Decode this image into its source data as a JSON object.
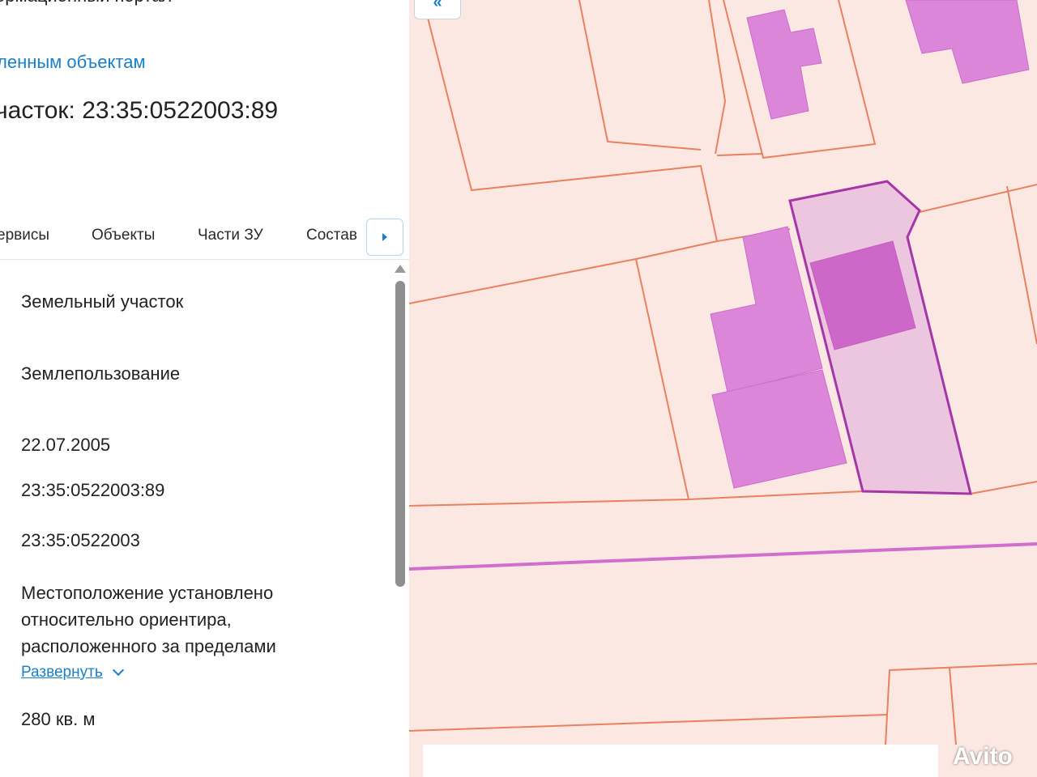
{
  "panel": {
    "portal_title": "ормационный портал",
    "back_link": "ленным объектам",
    "parcel_heading": "часток: 23:35:0522003:89",
    "tabs": [
      "ервисы",
      "Объекты",
      "Части ЗУ",
      "Состав"
    ],
    "fields": {
      "object_type": "Земельный участок",
      "right_type": "Землепользование",
      "date": "22.07.2005",
      "cadastral_number": "23:35:0522003:89",
      "quarter": "23:35:0522003",
      "location": "Местоположение установлено относительно ориентира, расположенного за пределами",
      "expand": "Развернуть",
      "area": "280 кв. м"
    }
  },
  "map": {
    "collapse_button": "«",
    "colors": {
      "background": "#fce8e3",
      "boundary": "#e9805f",
      "building": "#dc86da",
      "selected_outline": "#a536a8",
      "selected_fill": "#ecc5de"
    }
  },
  "watermark": "Avito"
}
